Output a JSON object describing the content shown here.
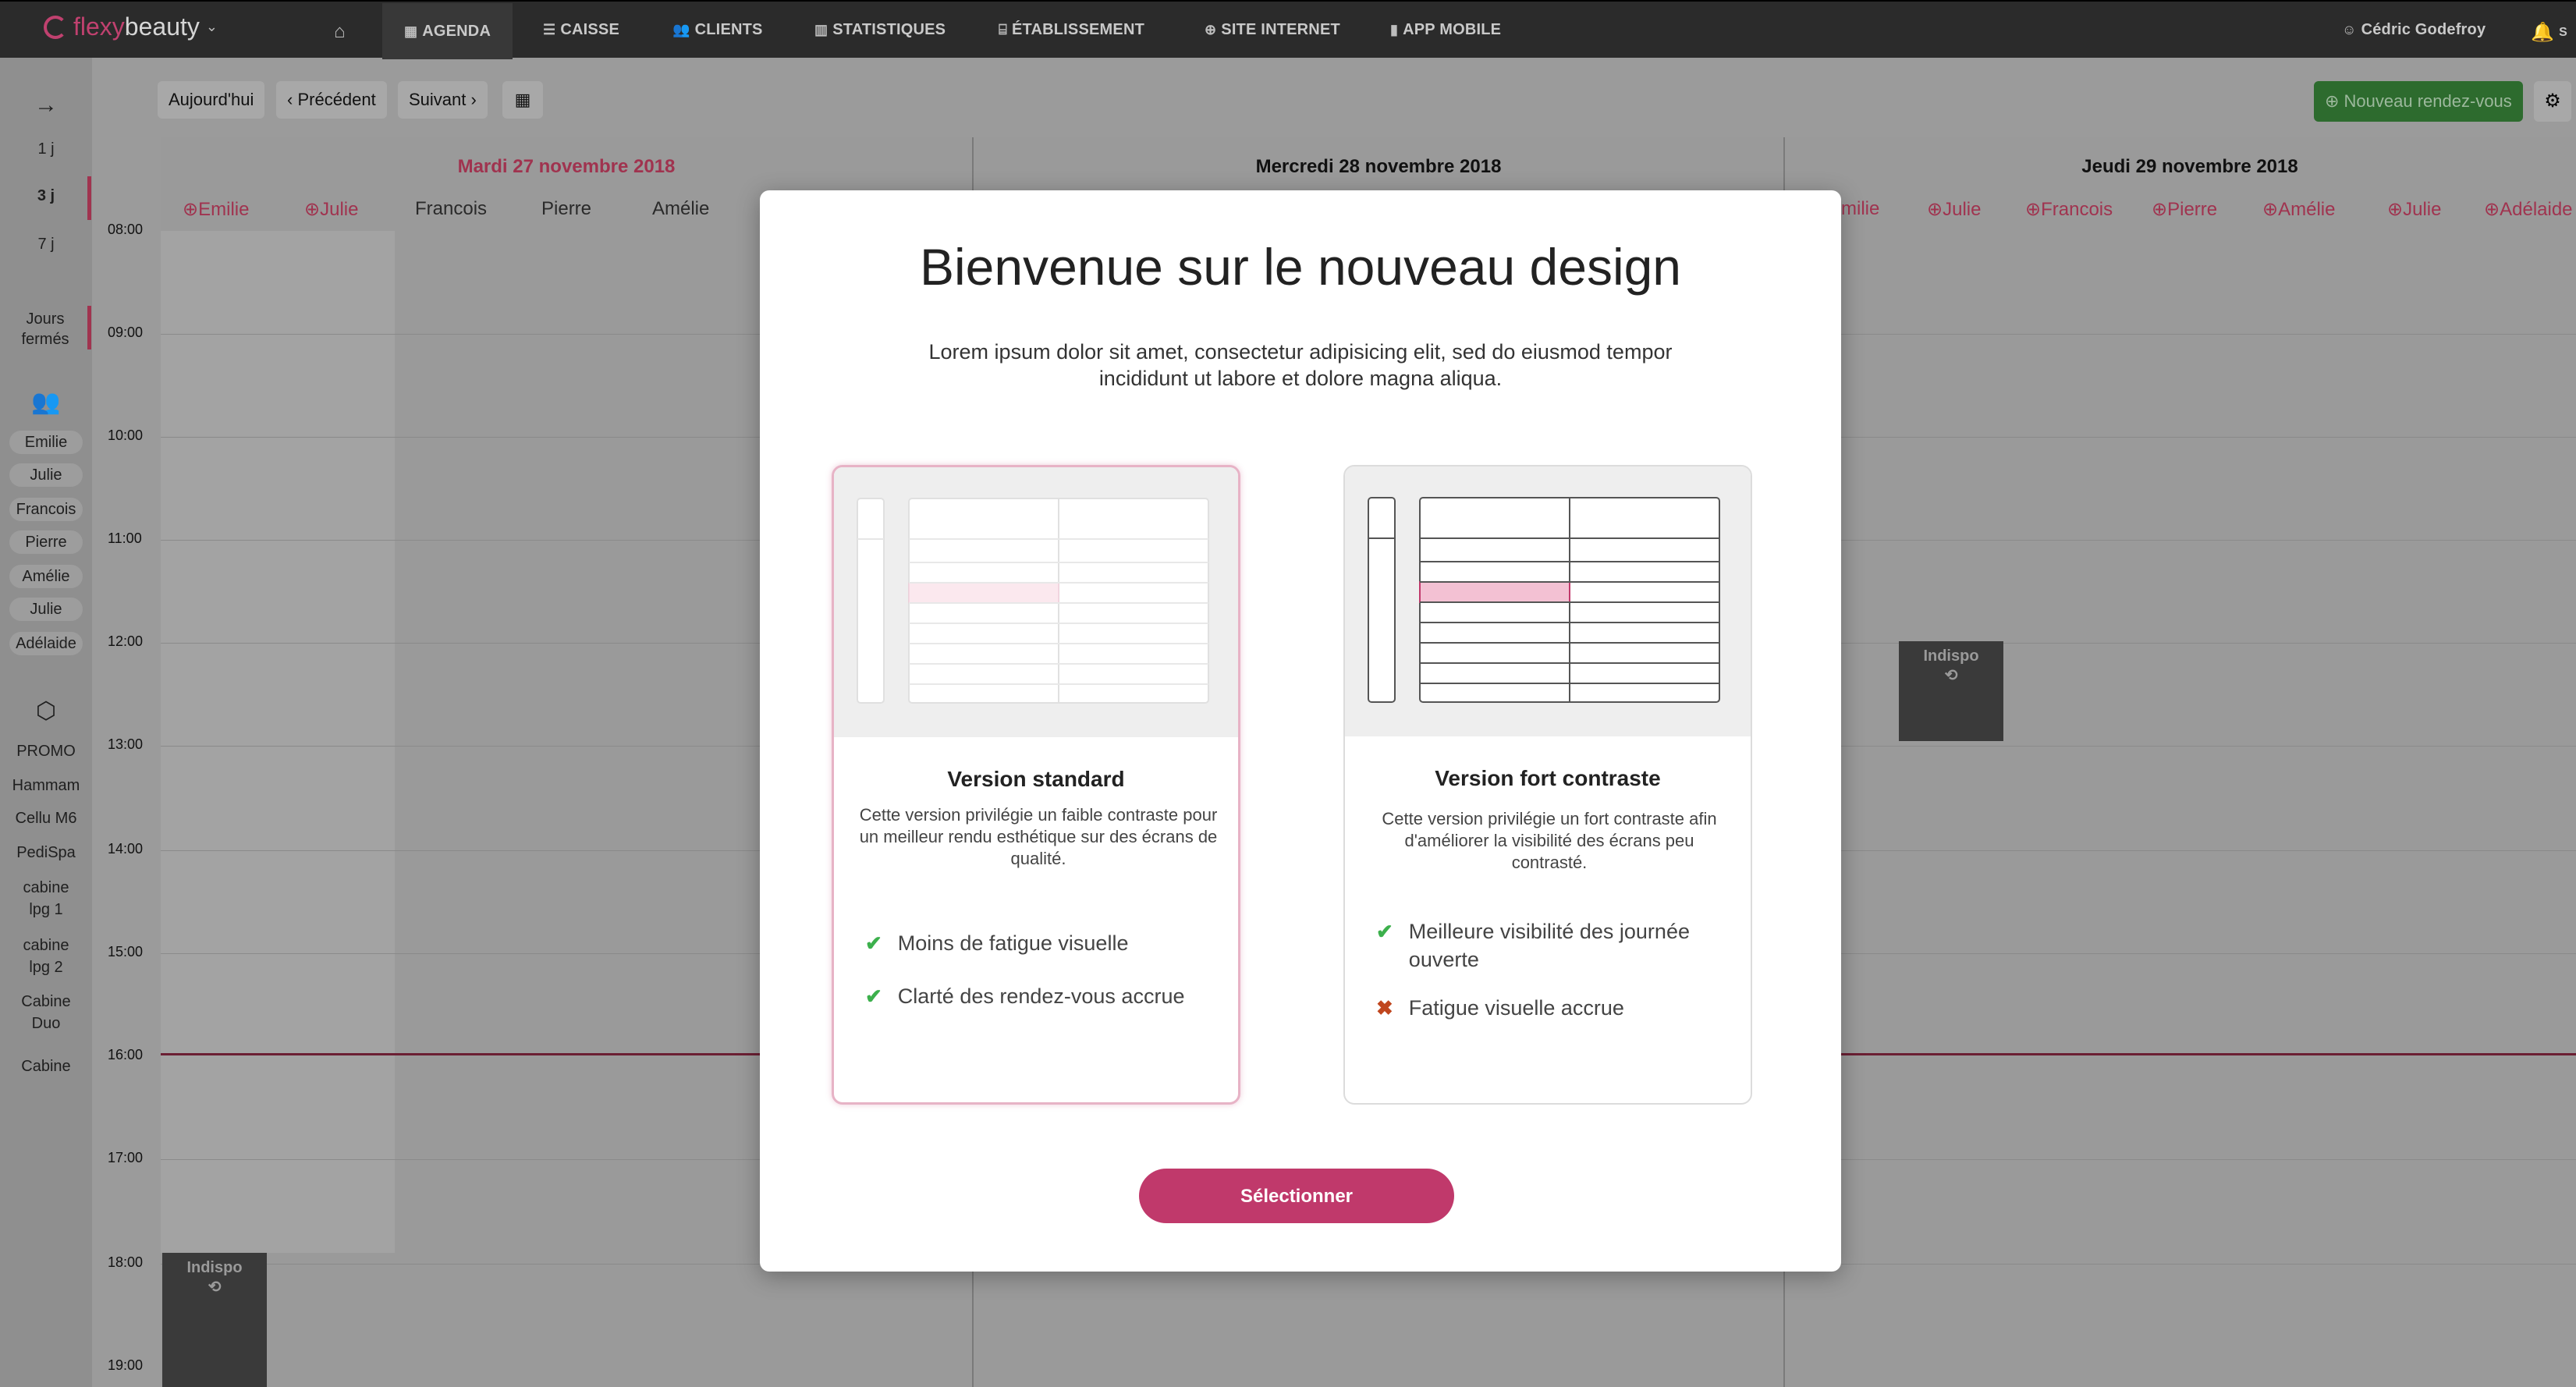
{
  "brand": {
    "part1": "flexy",
    "part2": "beauty"
  },
  "nav": {
    "items": [
      {
        "label": "AGENDA"
      },
      {
        "label": "CAISSE"
      },
      {
        "label": "CLIENTS"
      },
      {
        "label": "STATISTIQUES"
      },
      {
        "label": "ÉTABLISSEMENT"
      },
      {
        "label": "SITE INTERNET"
      },
      {
        "label": "APP MOBILE"
      }
    ],
    "user": "Cédric Godefroy",
    "user_extra": "S"
  },
  "toolbar": {
    "today": "Aujourd'hui",
    "prev": "Précédent",
    "next": "Suivant",
    "new_appointment": "Nouveau rendez-vous"
  },
  "rail": {
    "views": [
      "1 j",
      "3 j",
      "7 j"
    ],
    "closed_days": "Jours fermés",
    "staff": [
      "Emilie",
      "Julie",
      "Francois",
      "Pierre",
      "Amélie",
      "Julie",
      "Adélaide"
    ],
    "rooms": [
      "PROMO",
      "Hammam",
      "Cellu M6",
      "PediSpa",
      "cabine lpg 1",
      "cabine lpg 2",
      "Cabine Duo",
      "Cabine"
    ]
  },
  "hours": [
    "08:00",
    "09:00",
    "10:00",
    "11:00",
    "12:00",
    "13:00",
    "14:00",
    "15:00",
    "16:00",
    "17:00",
    "18:00",
    "19:00"
  ],
  "days": [
    {
      "label": "Mardi 27 novembre 2018"
    },
    {
      "label": "Mercredi 28 novembre 2018"
    },
    {
      "label": "Jeudi 29 novembre 2018"
    }
  ],
  "staff_day1": [
    "Emilie",
    "Julie",
    "Francois",
    "Pierre",
    "Amélie"
  ],
  "staff_day3": [
    "milie",
    "Julie",
    "Francois",
    "Pierre",
    "Amélie",
    "Julie",
    "Adélaide"
  ],
  "indispo": "Indispo",
  "modal": {
    "title": "Bienvenue sur le nouveau design",
    "subtitle": "Lorem ipsum dolor sit amet, consectetur adipisicing elit, sed do eiusmod tempor incididunt ut labore et dolore magna aliqua.",
    "cards": [
      {
        "title": "Version standard",
        "desc": "Cette version privilégie un faible contraste pour un meilleur rendu esthétique sur des écrans de qualité.",
        "features": [
          {
            "text": "Moins de fatigue visuelle",
            "positive": true
          },
          {
            "text": "Clarté des rendez-vous accrue",
            "positive": true
          }
        ],
        "selected": true
      },
      {
        "title": "Version fort contraste",
        "desc": "Cette version privilégie un fort contraste afin d'améliorer la visibilité des écrans peu contrasté.",
        "features": [
          {
            "text": "Meilleure visibilité des journée ouverte",
            "positive": true
          },
          {
            "text": "Fatigue visuelle accrue",
            "positive": false
          }
        ],
        "selected": false
      }
    ],
    "select_label": "Sélectionner"
  },
  "colors": {
    "accent": "#c0396b",
    "success": "#3cb04c",
    "danger": "#c0461e",
    "nav_bg": "#2b2b2b"
  }
}
